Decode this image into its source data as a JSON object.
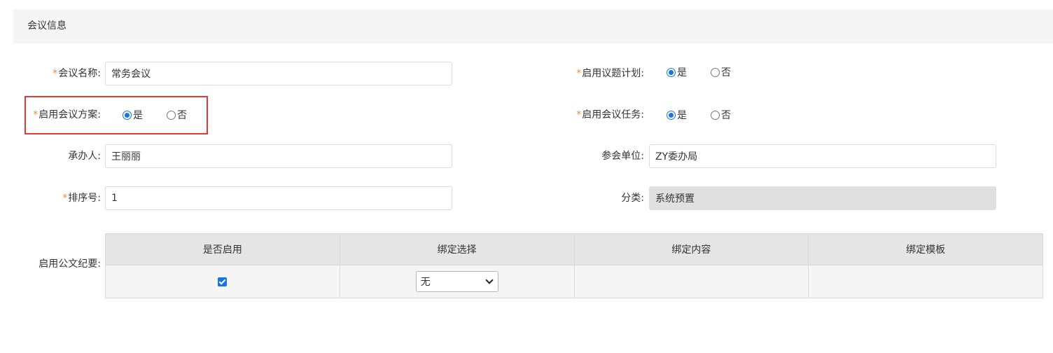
{
  "section": {
    "title": "会议信息"
  },
  "fields": {
    "meeting_name": {
      "label": "会议名称:",
      "value": "常务会议",
      "required": "*"
    },
    "enable_agenda_plan": {
      "label": "启用议题计划:",
      "required": "*",
      "options": [
        "是",
        "否"
      ],
      "selected": "是"
    },
    "enable_meeting_scheme": {
      "label": "启用会议方案:",
      "required": "*",
      "options": [
        "是",
        "否"
      ],
      "selected": "是"
    },
    "enable_meeting_task": {
      "label": "启用会议任务:",
      "required": "*",
      "options": [
        "是",
        "否"
      ],
      "selected": "是"
    },
    "organizer": {
      "label": "承办人:",
      "value": "王丽丽"
    },
    "participating_unit": {
      "label": "参会单位:",
      "value": "ZY委办局"
    },
    "sort_number": {
      "label": "排序号:",
      "value": "1",
      "required": "*"
    },
    "category": {
      "label": "分类:",
      "value": "系统预置"
    },
    "enable_minutes": {
      "label": "启用公文纪要:"
    }
  },
  "minutes_table": {
    "headers": [
      "是否启用",
      "绑定选择",
      "绑定内容",
      "绑定模板"
    ],
    "row": {
      "enabled": true,
      "binding_choice": "无",
      "binding_content": "",
      "binding_template": ""
    }
  },
  "colors": {
    "accent": "#1a73e8",
    "required": "#f08c3a",
    "highlight": "#e53935"
  }
}
